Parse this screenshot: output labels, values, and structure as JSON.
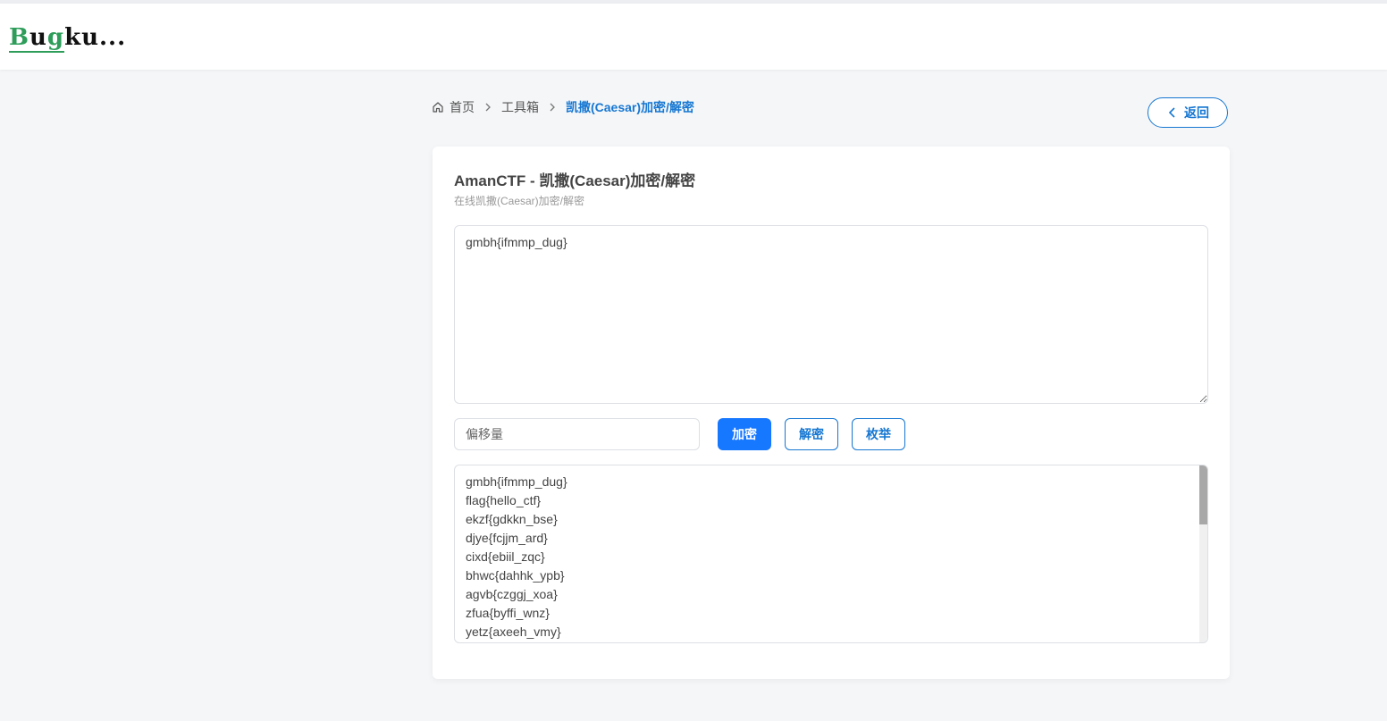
{
  "header": {
    "logo_text_prefix": "B",
    "logo_text_u": "u",
    "logo_text_g": "g",
    "logo_text_rest": "ku..."
  },
  "breadcrumb": {
    "home": "首页",
    "toolbox": "工具箱",
    "current": "凯撒(Caesar)加密/解密"
  },
  "back_button": {
    "label": "返回"
  },
  "card": {
    "title": "AmanCTF - 凯撒(Caesar)加密/解密",
    "subtitle": "在线凯撒(Caesar)加密/解密",
    "input_value": "gmbh{ifmmp_dug}",
    "offset_placeholder": "偏移量",
    "encrypt_label": "加密",
    "decrypt_label": "解密",
    "enumerate_label": "枚举",
    "output_lines": [
      "gmbh{ifmmp_dug}",
      "flag{hello_ctf}",
      "ekzf{gdkkn_bse}",
      "djye{fcjjm_ard}",
      "cixd{ebiil_zqc}",
      "bhwc{dahhk_ypb}",
      "agvb{czggj_xoa}",
      "zfua{byffi_wnz}",
      "yetz{axeeh_vmy}"
    ]
  },
  "colors": {
    "accent": "#1677d2",
    "primary_button": "#1677ff",
    "logo_green": "#2e9d5a"
  },
  "icons": {
    "home": "home-icon",
    "separator": "chevron-right-icon",
    "back": "chevron-left-icon"
  }
}
